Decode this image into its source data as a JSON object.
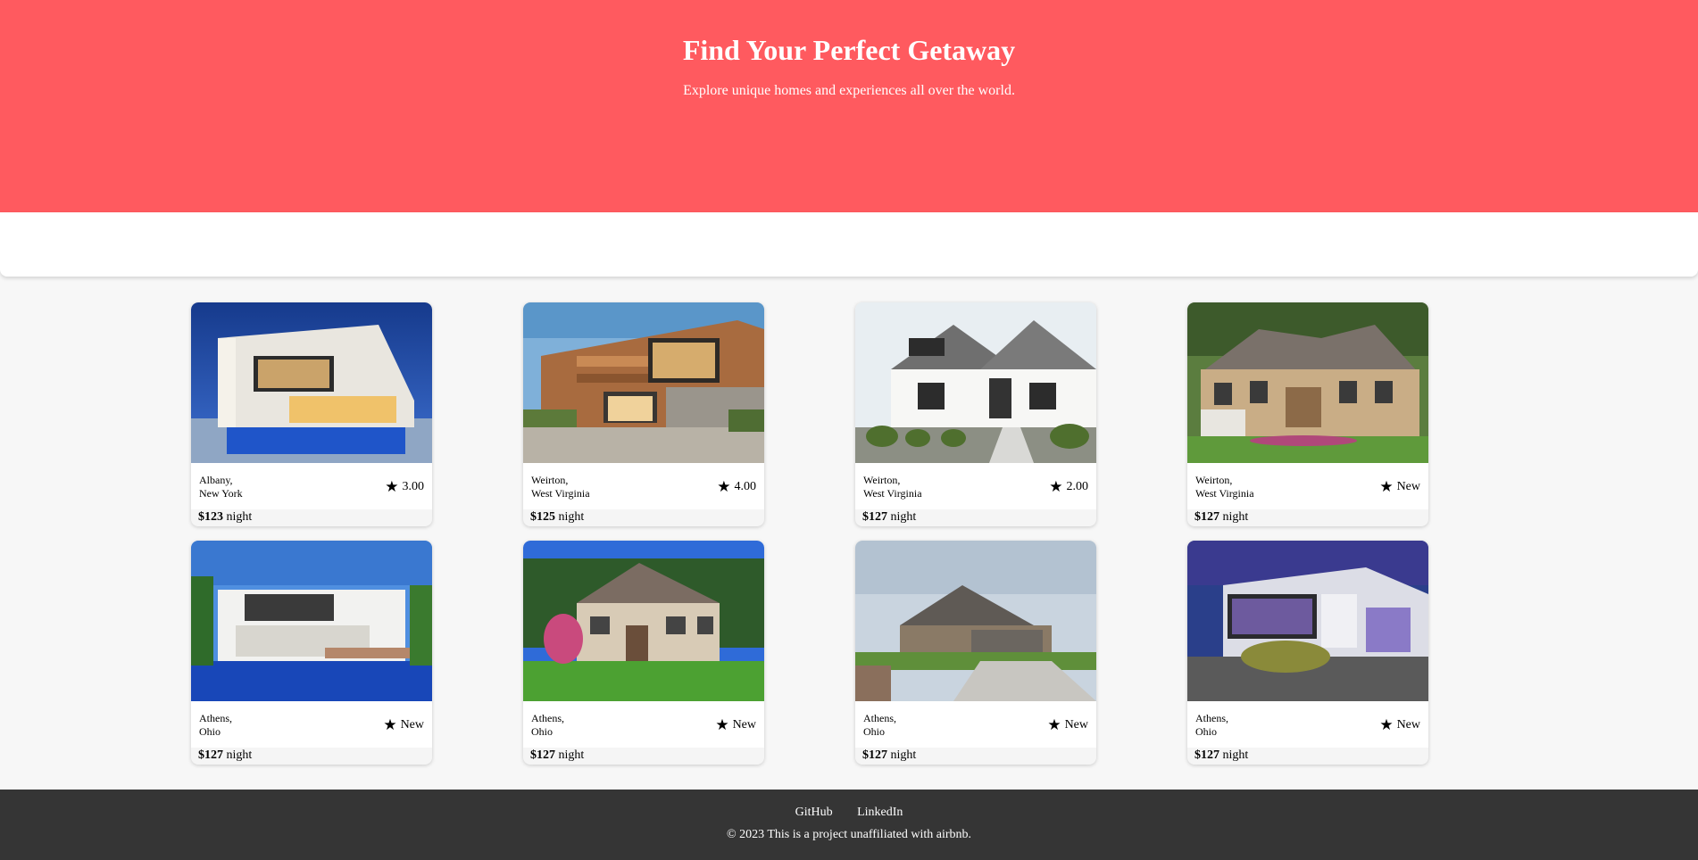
{
  "hero": {
    "title": "Find Your Perfect Getaway",
    "subtitle": "Explore unique homes and experiences all over the world."
  },
  "listings": [
    {
      "city": "Albany,",
      "state": "New York",
      "rating": "3.00",
      "price": "$123",
      "unit": "night",
      "image": "modern-villa-night"
    },
    {
      "city": "Weirton,",
      "state": "West Virginia",
      "rating": "4.00",
      "price": "$125",
      "unit": "night",
      "image": "wood-modern-house"
    },
    {
      "city": "Weirton,",
      "state": "West Virginia",
      "rating": "2.00",
      "price": "$127",
      "unit": "night",
      "image": "white-farmhouse"
    },
    {
      "city": "Weirton,",
      "state": "West Virginia",
      "rating": "New",
      "price": "$127",
      "unit": "night",
      "image": "stone-estate"
    },
    {
      "city": "Athens,",
      "state": "Ohio",
      "rating": "New",
      "price": "$127",
      "unit": "night",
      "image": "pool-villa"
    },
    {
      "city": "Athens,",
      "state": "Ohio",
      "rating": "New",
      "price": "$127",
      "unit": "night",
      "image": "suburban-house"
    },
    {
      "city": "Athens,",
      "state": "Ohio",
      "rating": "New",
      "price": "$127",
      "unit": "night",
      "image": "ranch-house"
    },
    {
      "city": "Athens,",
      "state": "Ohio",
      "rating": "New",
      "price": "$127",
      "unit": "night",
      "image": "modern-house-dusk"
    }
  ],
  "icons": {
    "rating": "star-icon"
  },
  "footer": {
    "links": [
      "GitHub",
      "LinkedIn"
    ],
    "copyright": "© 2023 This is a project unaffiliated with airbnb."
  },
  "colors": {
    "brand": "#ff5a5f",
    "footer": "#353535",
    "page": "#f7f7f7"
  }
}
